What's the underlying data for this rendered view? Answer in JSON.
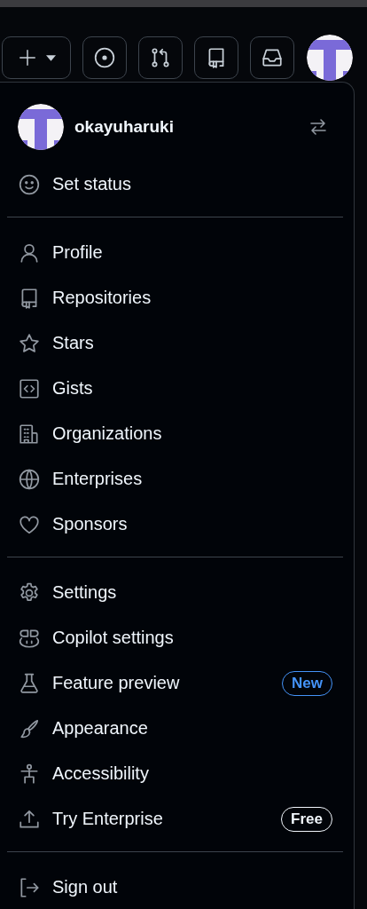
{
  "user": {
    "name": "okayuharuki"
  },
  "sections": [
    {
      "items": [
        {
          "label": "Set status"
        }
      ]
    },
    {
      "items": [
        {
          "label": "Profile"
        },
        {
          "label": "Repositories"
        },
        {
          "label": "Stars"
        },
        {
          "label": "Gists"
        },
        {
          "label": "Organizations"
        },
        {
          "label": "Enterprises"
        },
        {
          "label": "Sponsors"
        }
      ]
    },
    {
      "items": [
        {
          "label": "Settings"
        },
        {
          "label": "Copilot settings"
        },
        {
          "label": "Feature preview",
          "badge": {
            "text": "New",
            "kind": "accent"
          }
        },
        {
          "label": "Appearance"
        },
        {
          "label": "Accessibility"
        },
        {
          "label": "Try Enterprise",
          "badge": {
            "text": "Free",
            "kind": "default"
          }
        }
      ]
    },
    {
      "items": [
        {
          "label": "Sign out"
        }
      ]
    }
  ]
}
